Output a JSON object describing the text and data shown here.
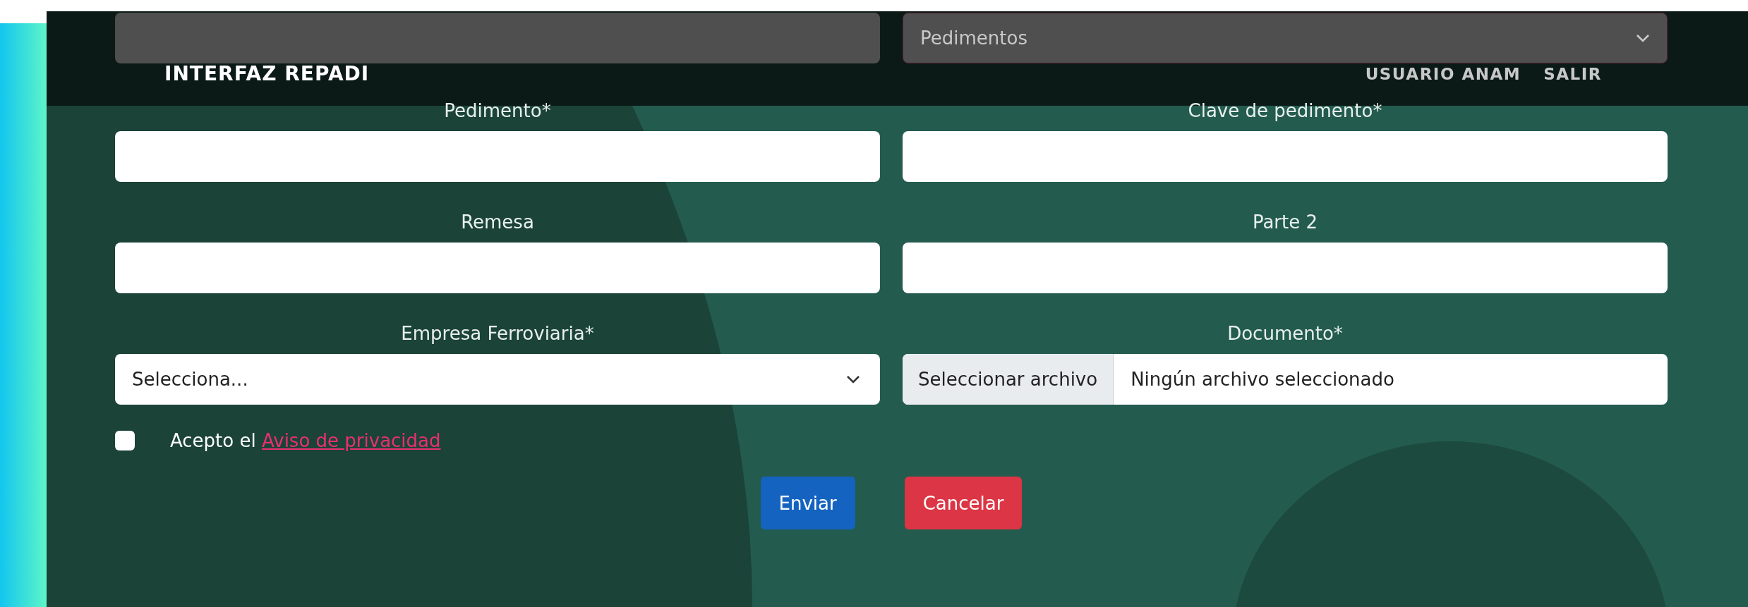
{
  "header": {
    "title": "INTERFAZ REPADI",
    "nav": [
      "USUARIO ANAM",
      "SALIR"
    ]
  },
  "top_row": {
    "select": {
      "value": "Pedimentos"
    }
  },
  "fields": [
    {
      "kind": "text",
      "label": "Pedimento*"
    },
    {
      "kind": "text",
      "label": "Clave de pedimento*"
    },
    {
      "kind": "text",
      "label": "Remesa"
    },
    {
      "kind": "text",
      "label": "Parte 2"
    },
    {
      "kind": "select",
      "label": "Empresa Ferroviaria*",
      "value": "Selecciona..."
    },
    {
      "kind": "file",
      "label": "Documento*",
      "button": "Seleccionar archivo",
      "status": "Ningún archivo seleccionado"
    }
  ],
  "privacy": {
    "checked": false,
    "text": "Acepto el",
    "link": "Aviso de privacidad"
  },
  "buttons": [
    {
      "kind": "primary",
      "label": "Enviar"
    },
    {
      "kind": "danger",
      "label": "Cancelar"
    }
  ]
}
